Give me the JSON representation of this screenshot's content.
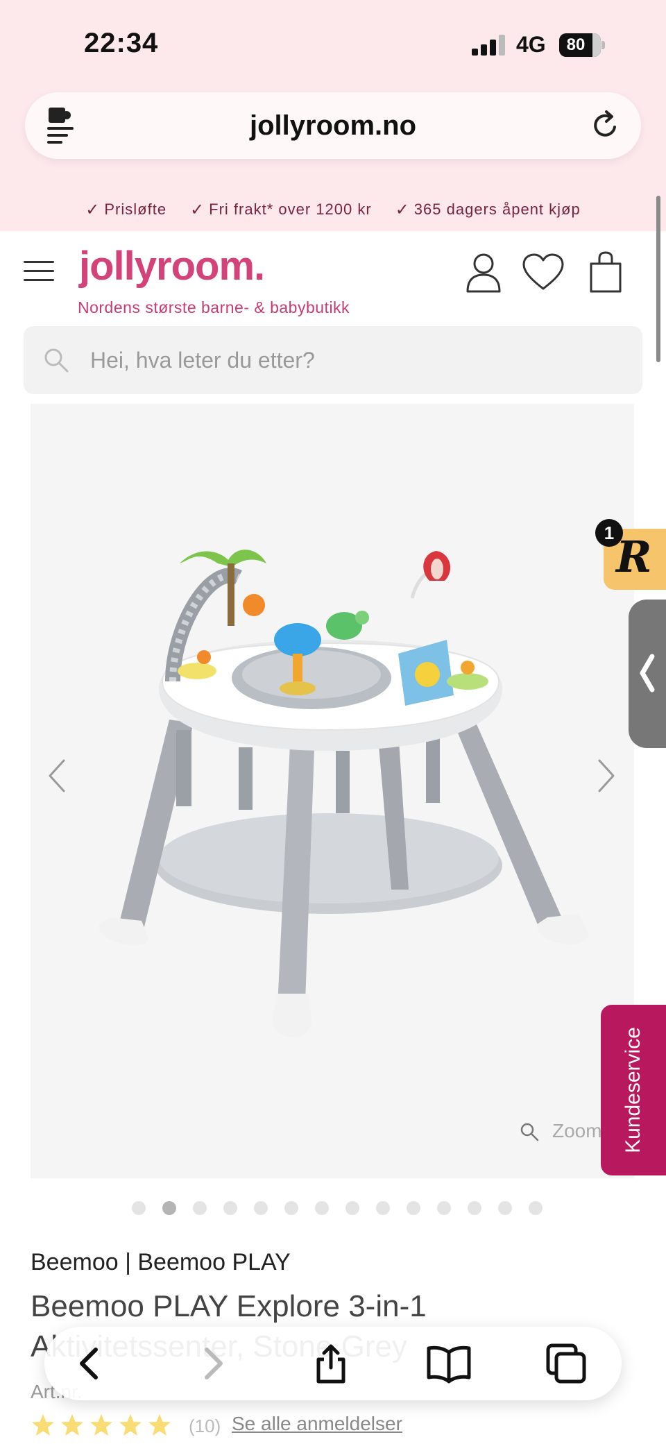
{
  "status_bar": {
    "time": "22:34",
    "network": "4G",
    "battery": "80",
    "battery_level": 0.8
  },
  "browser": {
    "url": "jollyroom.no",
    "reader_icon": "reader-view-icon",
    "reload_icon": "reload-icon"
  },
  "promos": [
    {
      "label": "Prisløfte"
    },
    {
      "label": "Fri frakt* over 1200 kr"
    },
    {
      "label": "365 dagers åpent kjøp"
    }
  ],
  "header": {
    "logo": "jollyroom.",
    "tagline": "Nordens største barne- & babybutikk",
    "icons": [
      "account-icon",
      "wishlist-heart-icon",
      "cart-bag-icon"
    ]
  },
  "search": {
    "placeholder": "Hei, hva leter du etter?"
  },
  "gallery": {
    "zoom_label": "Zoom",
    "total_images": 14,
    "active_index": 1
  },
  "widgets": {
    "reward_count": "1",
    "reward_letter": "R",
    "customer_service": "Kundeservice"
  },
  "product": {
    "brand": "Beemoo | Beemoo PLAY",
    "title": "Beemoo PLAY Explore 3-in-1 Aktivitetssenter, Stone Grey",
    "article": "Art.nr.",
    "rating": 5,
    "review_count": "(10)",
    "reviews_link": "Se alle anmeldelser"
  },
  "toolbar": {
    "buttons": [
      "back-icon",
      "forward-icon",
      "share-icon",
      "bookmarks-icon",
      "tabs-icon"
    ]
  },
  "colors": {
    "brand_pink": "#d4427a",
    "customer_service_bg": "#b8185e",
    "chrome_bg": "#fde8ec",
    "star": "#f5c518"
  }
}
